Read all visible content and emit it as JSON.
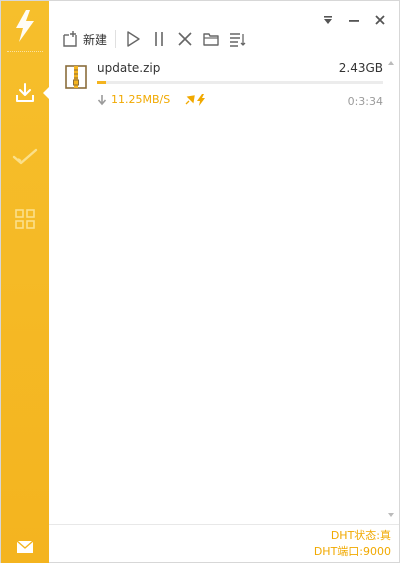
{
  "toolbar": {
    "new_label": "新建"
  },
  "task": {
    "name": "update.zip",
    "size": "2.43GB",
    "speed": "11.25MB/S",
    "time_left": "0:3:34",
    "progress_percent": 3
  },
  "status": {
    "dht_state": "DHT状态:真",
    "dht_port": "DHT端口:9000"
  },
  "colors": {
    "accent": "#f4b41f",
    "speed_text": "#f1a900",
    "sidebar_bg": "#f6bf2c"
  },
  "icons": {
    "sidebar": [
      "lightning-logo-icon",
      "download-icon",
      "check-icon",
      "grid-icon",
      "mail-icon"
    ],
    "toolbar": [
      "new-task-icon",
      "play-icon",
      "pause-icon",
      "delete-icon",
      "folder-icon",
      "list-icon"
    ],
    "window": [
      "dropdown-icon",
      "minimize-icon",
      "close-icon"
    ]
  }
}
